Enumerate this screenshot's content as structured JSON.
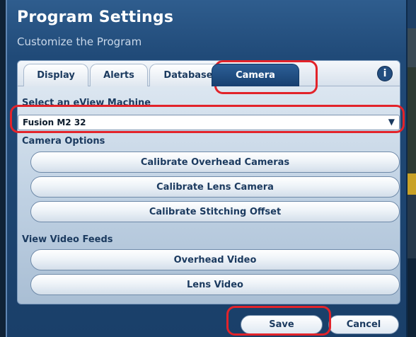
{
  "dialog": {
    "title": "Program Settings",
    "subtitle": "Customize the Program"
  },
  "tabs": [
    {
      "label": "Display"
    },
    {
      "label": "Alerts"
    },
    {
      "label": "Database"
    },
    {
      "label": "Camera",
      "selected": true
    }
  ],
  "info_icon": "i",
  "machine_select": {
    "label": "Select an eView Machine",
    "value": "Fusion M2 32",
    "arrow": "▼"
  },
  "camera_options": {
    "label": "Camera Options",
    "buttons": [
      "Calibrate Overhead Cameras",
      "Calibrate Lens Camera",
      "Calibrate Stitching Offset"
    ]
  },
  "video_feeds": {
    "label": "View Video Feeds",
    "buttons": [
      "Overhead Video",
      "Lens Video"
    ]
  },
  "footer": {
    "save": "Save",
    "cancel": "Cancel"
  },
  "colors": {
    "highlight": "#e2232a",
    "accent": "#1b3a5f",
    "selected_tab": "#2c5f97"
  }
}
